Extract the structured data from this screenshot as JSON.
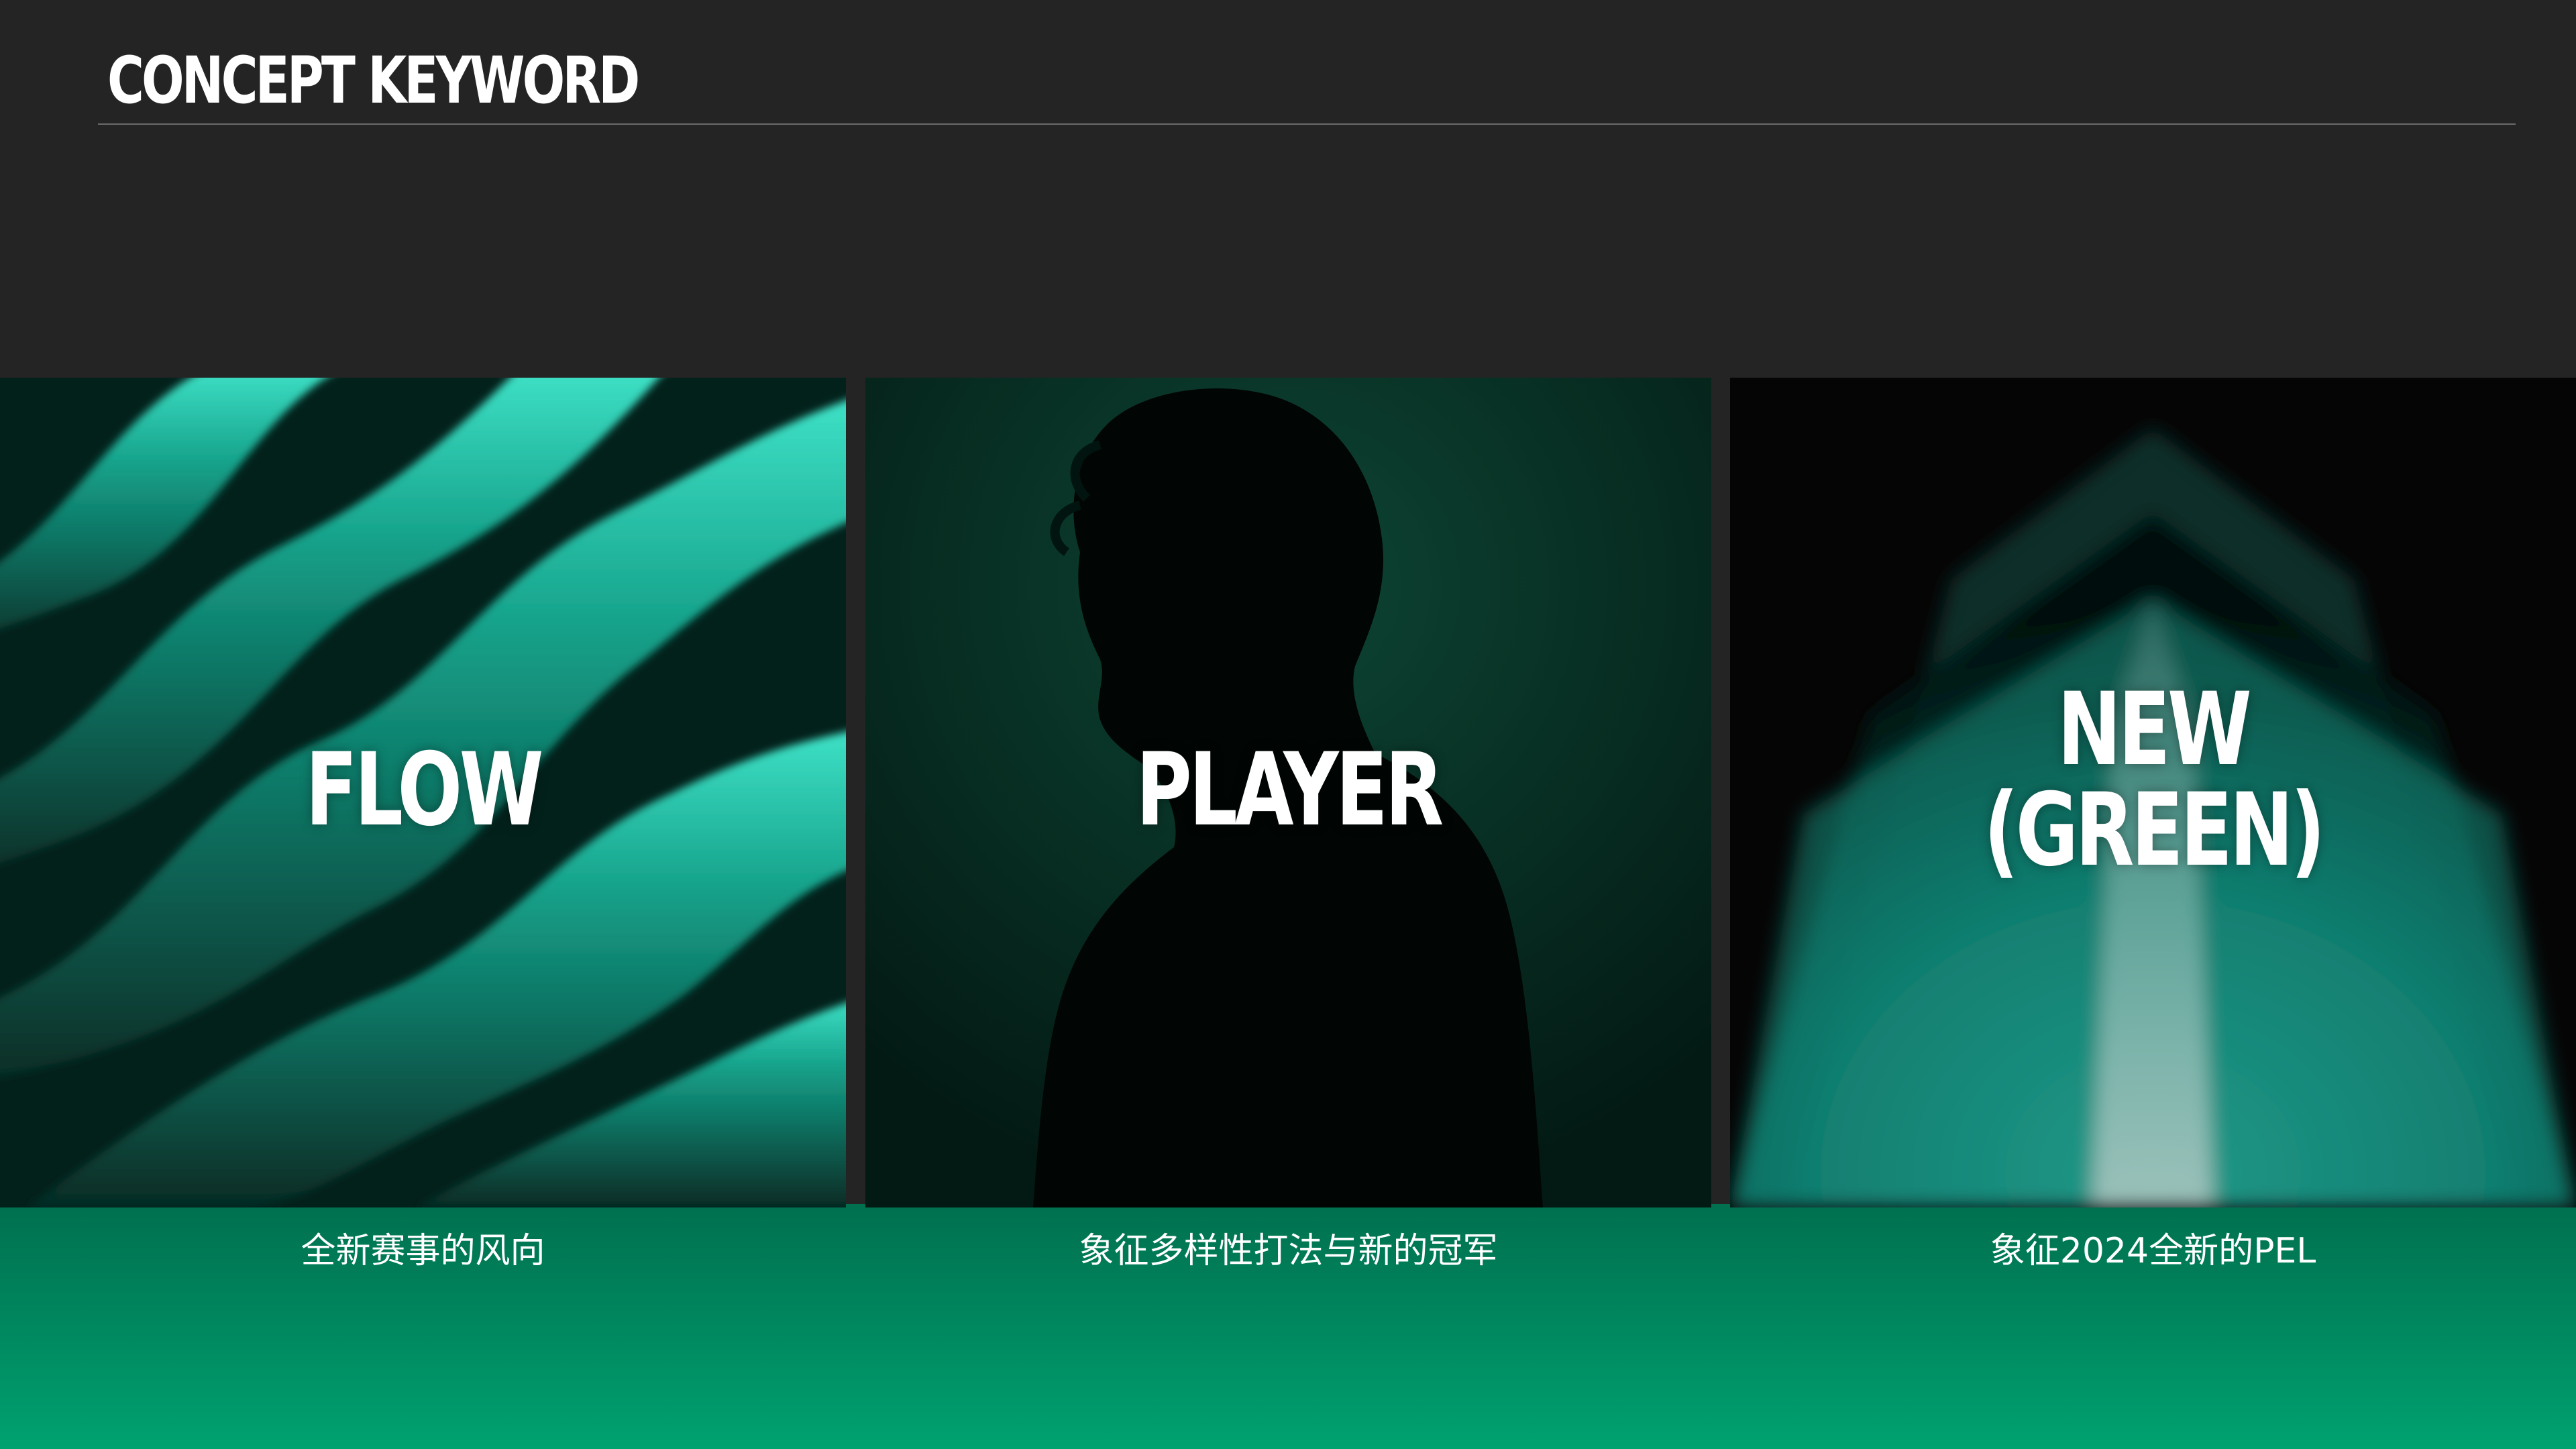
{
  "header": {
    "title": "CONCEPT KEYWORD"
  },
  "panels": [
    {
      "keyword": "FLOW",
      "caption": "全新赛事的风向"
    },
    {
      "keyword": "PLAYER",
      "caption": "象征多样性打法与新的冠军"
    },
    {
      "keyword_line1": "NEW",
      "keyword_line2": "(GREEN)",
      "caption": "象征2024全新的PEL"
    }
  ],
  "colors": {
    "background": "#242424",
    "accent_green": "#00a270",
    "teal_glow": "#2fd9bd"
  }
}
